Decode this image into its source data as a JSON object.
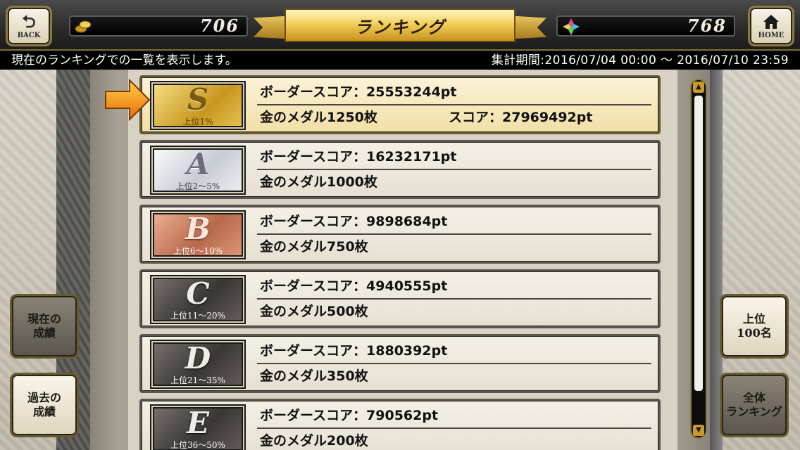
{
  "header": {
    "back_label": "BACK",
    "home_label": "HOME",
    "title": "ランキング",
    "coin_value": "706",
    "gem_value": "768"
  },
  "info": {
    "description": "現在のランキングでの一覧を表示します。",
    "period": "集計期間:2016/07/04 00:00 ～ 2016/07/10 23:59"
  },
  "sidebar_left": {
    "current_label": "現在の\n成績",
    "past_label": "過去の\n成績"
  },
  "sidebar_right": {
    "top100_label": "上位\n100名",
    "all_label": "全体\nランキング"
  },
  "ranks": [
    {
      "letter": "S",
      "range": "上位1%",
      "border": "ボーダースコア：25553244pt",
      "reward": "金のメダル1250枚",
      "my_score": "スコア：27969492pt",
      "highlight": true
    },
    {
      "letter": "A",
      "range": "上位2～5%",
      "border": "ボーダースコア：16232171pt",
      "reward": "金のメダル1000枚"
    },
    {
      "letter": "B",
      "range": "上位6～10%",
      "border": "ボーダースコア：9898684pt",
      "reward": "金のメダル750枚"
    },
    {
      "letter": "C",
      "range": "上位11～20%",
      "border": "ボーダースコア：4940555pt",
      "reward": "金のメダル500枚"
    },
    {
      "letter": "D",
      "range": "上位21～35%",
      "border": "ボーダースコア：1880392pt",
      "reward": "金のメダル350枚"
    },
    {
      "letter": "E",
      "range": "上位36～50%",
      "border": "ボーダースコア：790562pt",
      "reward": "金のメダル200枚"
    }
  ],
  "colors": {
    "accent_gold": "#f2cf5a",
    "highlight_row": "#f1dfa6",
    "arrow_orange": "#f08a10"
  },
  "icons": [
    "back-arrow-icon",
    "home-icon",
    "coin-icon",
    "gem-icon",
    "pointer-arrow-icon",
    "scroll-up-icon",
    "scroll-down-icon"
  ]
}
